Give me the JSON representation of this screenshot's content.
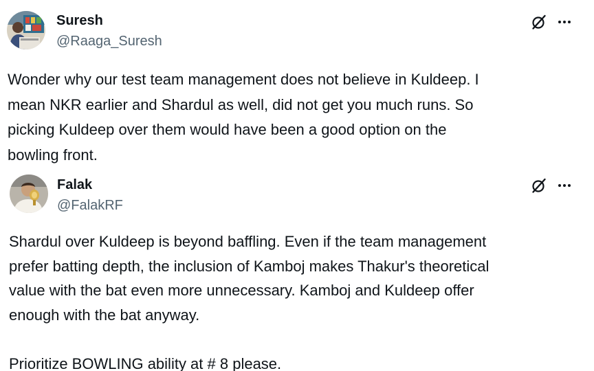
{
  "tweets": [
    {
      "display_name": "Suresh",
      "handle": "@Raaga_Suresh",
      "avatar_icon": "user-photo-avatar",
      "icons": [
        "grok-slash-icon",
        "more-options-icon"
      ],
      "text_lines": [
        "Wonder why our test team management does not believe in Kuldeep. I",
        "mean NKR earlier and Shardul as well, did not get you much runs. So",
        "picking Kuldeep over them would have been a good option on the",
        "bowling front."
      ]
    },
    {
      "display_name": "Falak",
      "handle": "@FalakRF",
      "avatar_icon": "user-photo-avatar",
      "icons": [
        "grok-slash-icon",
        "more-options-icon"
      ],
      "text_lines": [
        "Shardul over Kuldeep is beyond baffling. Even if the team management",
        "prefer batting depth, the inclusion of Kamboj makes Thakur's theoretical",
        "value with the bat even more unnecessary. Kamboj and Kuldeep offer",
        "enough with the bat anyway."
      ],
      "text_lines_after_break": [
        "Prioritize BOWLING ability at # 8 please."
      ]
    }
  ],
  "colors": {
    "text_primary": "#0f1419",
    "text_secondary": "#536471",
    "background": "#ffffff"
  }
}
